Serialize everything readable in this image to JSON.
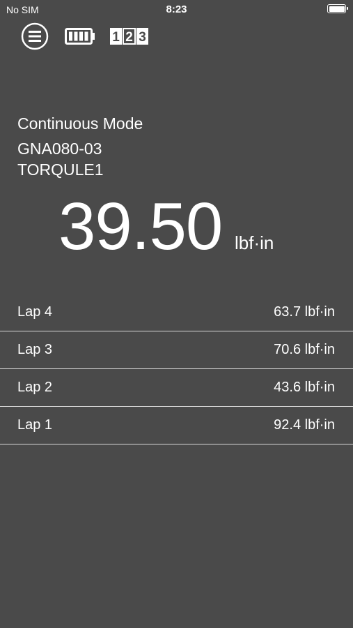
{
  "status_bar": {
    "carrier": "No SIM",
    "time": "8:23"
  },
  "toolbar": {
    "menu_icon": "hamburger-menu-icon",
    "battery_icon": "battery-full-icon",
    "counter_icon": "counter-123-icon",
    "counter_digits": [
      "1",
      "2",
      "3"
    ]
  },
  "measurement": {
    "mode": "Continuous Mode",
    "model": "GNA080-03",
    "device": "TORQULE1",
    "value": "39.50",
    "unit": "lbf·in"
  },
  "laps": [
    {
      "label": "Lap 4",
      "value": "63.7 lbf·in"
    },
    {
      "label": "Lap 3",
      "value": "70.6 lbf·in"
    },
    {
      "label": "Lap 2",
      "value": "43.6 lbf·in"
    },
    {
      "label": "Lap 1",
      "value": "92.4 lbf·in"
    }
  ],
  "colors": {
    "background": "#4a4a4a",
    "text": "#ffffff",
    "divider": "#d9d9d9"
  }
}
